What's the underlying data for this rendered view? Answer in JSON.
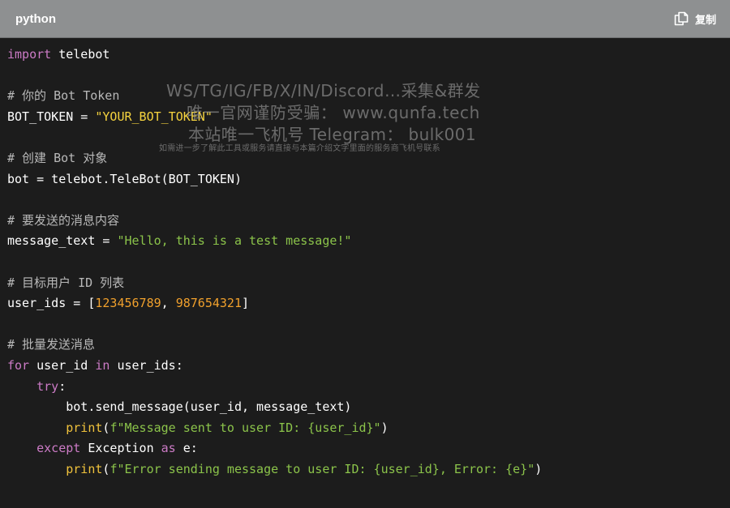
{
  "header": {
    "language": "python",
    "copy_label": "复制",
    "copy_icon": "copy-icon"
  },
  "code_lines": [
    [
      {
        "t": "import",
        "c": "kw"
      },
      {
        "t": " telebot",
        "c": "plain"
      }
    ],
    [],
    [
      {
        "t": "# 你的 Bot Token",
        "c": "com"
      }
    ],
    [
      {
        "t": "BOT_TOKEN = ",
        "c": "plain"
      },
      {
        "t": "\"YOUR_BOT_TOKEN\"",
        "c": "strhl"
      }
    ],
    [],
    [
      {
        "t": "# 创建 Bot 对象",
        "c": "com"
      }
    ],
    [
      {
        "t": "bot = telebot.TeleBot(BOT_TOKEN)",
        "c": "plain"
      }
    ],
    [],
    [
      {
        "t": "# 要发送的消息内容",
        "c": "com"
      }
    ],
    [
      {
        "t": "message_text = ",
        "c": "plain"
      },
      {
        "t": "\"Hello, this is a test message!\"",
        "c": "str"
      }
    ],
    [],
    [
      {
        "t": "# 目标用户 ID 列表",
        "c": "com"
      }
    ],
    [
      {
        "t": "user_ids = [",
        "c": "plain"
      },
      {
        "t": "123456789",
        "c": "num"
      },
      {
        "t": ", ",
        "c": "plain"
      },
      {
        "t": "987654321",
        "c": "num"
      },
      {
        "t": "]",
        "c": "plain"
      }
    ],
    [],
    [
      {
        "t": "# 批量发送消息",
        "c": "com"
      }
    ],
    [
      {
        "t": "for",
        "c": "kw"
      },
      {
        "t": " user_id ",
        "c": "plain"
      },
      {
        "t": "in",
        "c": "kw"
      },
      {
        "t": " user_ids:",
        "c": "plain"
      }
    ],
    [
      {
        "t": "    ",
        "c": "plain"
      },
      {
        "t": "try",
        "c": "kw"
      },
      {
        "t": ":",
        "c": "plain"
      }
    ],
    [
      {
        "t": "        bot.send_message(user_id, message_text)",
        "c": "plain"
      }
    ],
    [
      {
        "t": "        ",
        "c": "plain"
      },
      {
        "t": "print",
        "c": "fn"
      },
      {
        "t": "(",
        "c": "plain"
      },
      {
        "t": "f\"Message sent to user ID: {user_id}\"",
        "c": "str"
      },
      {
        "t": ")",
        "c": "plain"
      }
    ],
    [
      {
        "t": "    ",
        "c": "plain"
      },
      {
        "t": "except",
        "c": "kw"
      },
      {
        "t": " Exception ",
        "c": "plain"
      },
      {
        "t": "as",
        "c": "kw"
      },
      {
        "t": " e:",
        "c": "plain"
      }
    ],
    [
      {
        "t": "        ",
        "c": "plain"
      },
      {
        "t": "print",
        "c": "fn"
      },
      {
        "t": "(",
        "c": "plain"
      },
      {
        "t": "f\"Error sending message to user ID: {user_id}, Error: {e}\"",
        "c": "str"
      },
      {
        "t": ")",
        "c": "plain"
      }
    ]
  ],
  "watermark": {
    "line1": "WS/TG/IG/FB/X/IN/Discord…采集&群发",
    "line2": "唯一官网谨防受骗： www.qunfa.tech",
    "line3": "本站唯一飞机号 Telegram： bulk001",
    "line4": "如需进一步了解此工具或服务请直接与本篇介绍文字里面的服务商飞机号联系"
  },
  "colors": {
    "header_bg": "#8e9091",
    "code_bg": "#1c1c1c",
    "keyword": "#cc7bc6",
    "string": "#8bc34a",
    "string_highlight": "#f5d33e",
    "number": "#f0a02c",
    "builtin": "#f0c23c",
    "comment": "#b9b9b9"
  }
}
